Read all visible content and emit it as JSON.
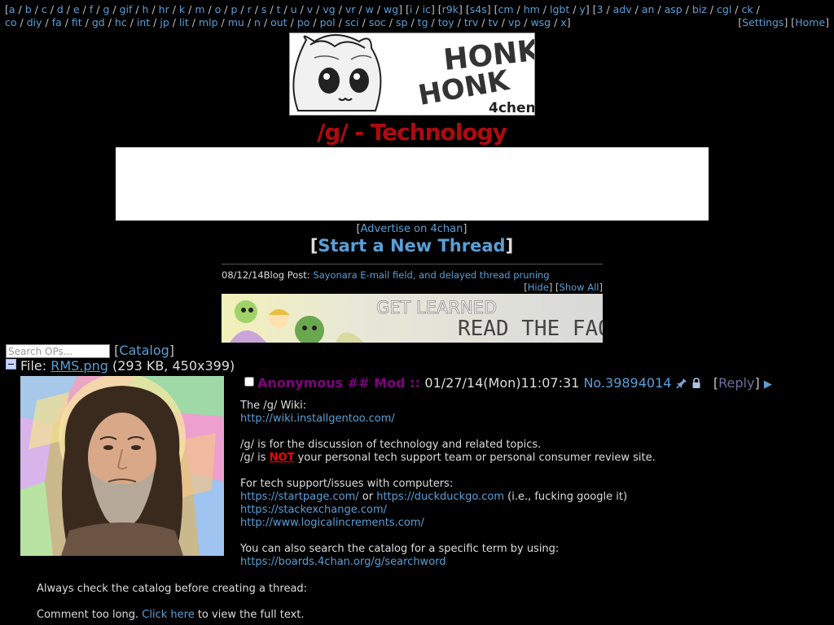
{
  "nav": {
    "row1": [
      "[",
      "a",
      " / ",
      "b",
      " / ",
      "c",
      " / ",
      "d",
      " / ",
      "e",
      " / ",
      "f",
      " / ",
      "g",
      " / ",
      "gif",
      " / ",
      "h",
      " / ",
      "hr",
      " / ",
      "k",
      " / ",
      "m",
      " / ",
      "o",
      " / ",
      "p",
      " / ",
      "r",
      " / ",
      "s",
      " / ",
      "t",
      " / ",
      "u",
      " / ",
      "v",
      " / ",
      "vg",
      " / ",
      "vr",
      " / ",
      "w",
      " / ",
      "wg",
      "] [",
      "i",
      " / ",
      "ic",
      "] [",
      "r9k",
      "] [",
      "s4s",
      "] [",
      "cm",
      " / ",
      "hm",
      " / ",
      "lgbt",
      " / ",
      "y",
      "] [",
      "3",
      " / ",
      "adv",
      " / ",
      "an",
      " / ",
      "asp",
      " / ",
      "biz",
      " / ",
      "cgl",
      " / ",
      "ck",
      " /"
    ],
    "row2": [
      "co",
      " / ",
      "diy",
      " / ",
      "fa",
      " / ",
      "fit",
      " / ",
      "gd",
      " / ",
      "hc",
      " / ",
      "int",
      " / ",
      "jp",
      " / ",
      "lit",
      " / ",
      "mlp",
      " / ",
      "mu",
      " / ",
      "n",
      " / ",
      "out",
      " / ",
      "po",
      " / ",
      "pol",
      " / ",
      "sci",
      " / ",
      "soc",
      " / ",
      "sp",
      " / ",
      "tg",
      " / ",
      "toy",
      " / ",
      "trv",
      " / ",
      "tv",
      " / ",
      "vp",
      " / ",
      "wsg",
      " / ",
      "x",
      "]"
    ],
    "settings_label": "Settings",
    "home_label": "Home"
  },
  "banner": {
    "line1": "HONK",
    "line2": "HONK",
    "tag": "4chen"
  },
  "board": {
    "title": "/g/ - Technology"
  },
  "advertise": {
    "open": "[",
    "label": "Advertise on 4chan",
    "close": "]"
  },
  "start_thread": {
    "open": "[",
    "label": "Start a New Thread",
    "close": "]"
  },
  "blog": {
    "date": "08/12/14",
    "prefix": "Blog Post: ",
    "link": "Sayonara E-mail field, and delayed thread pruning",
    "hide_label": "Hide",
    "show_all_label": "Show All"
  },
  "faq_banner": {
    "line1": "GET LEARNED",
    "line2": "READ THE FAQ"
  },
  "search": {
    "placeholder": "Search OPs...",
    "catalog_label": "Catalog"
  },
  "file": {
    "prefix": "File: ",
    "name": "RMS.png",
    "meta": " (293 KB, 450x399)"
  },
  "post": {
    "name": "Anonymous ## Mod",
    "sep": " :: ",
    "datetime": "01/27/14(Mon)11:07:31",
    "number": "No.39894014",
    "reply_label": "Reply",
    "arrow": "▶",
    "body": {
      "wiki_intro": "The /g/ Wiki:",
      "wiki_url": "http://wiki.installgentoo.com/",
      "line_discussion": "/g/ is for the discussion of technology and related topics.",
      "line_not_prefix": "/g/ is ",
      "line_not_word": "NOT",
      "line_not_suffix": " your personal tech support team or personal consumer review site.",
      "support_intro": "For tech support/issues with computers:",
      "startpage": "https://startpage.com/",
      "or": " or ",
      "duckduckgo": "https://duckduckgo.com",
      "ie": " (i.e., fucking google it)",
      "stackexchange": "https://stackexchange.com/",
      "logical": "http://www.logicalincrements.com/",
      "search_intro": "You can also search the catalog for a specific term by using:",
      "searchword": "https://boards.4chan.org/g/searchword"
    },
    "tail": {
      "always_check": "Always check the catalog before creating a thread:",
      "too_long": "Comment too long. ",
      "click_here": "Click here",
      "view_full": " to view the full text."
    }
  },
  "colors": {
    "background": "#000000",
    "link": "#5a9fd6",
    "title": "#af0a0f",
    "mod_name": "#800080",
    "emphasis": "#ff0000"
  }
}
